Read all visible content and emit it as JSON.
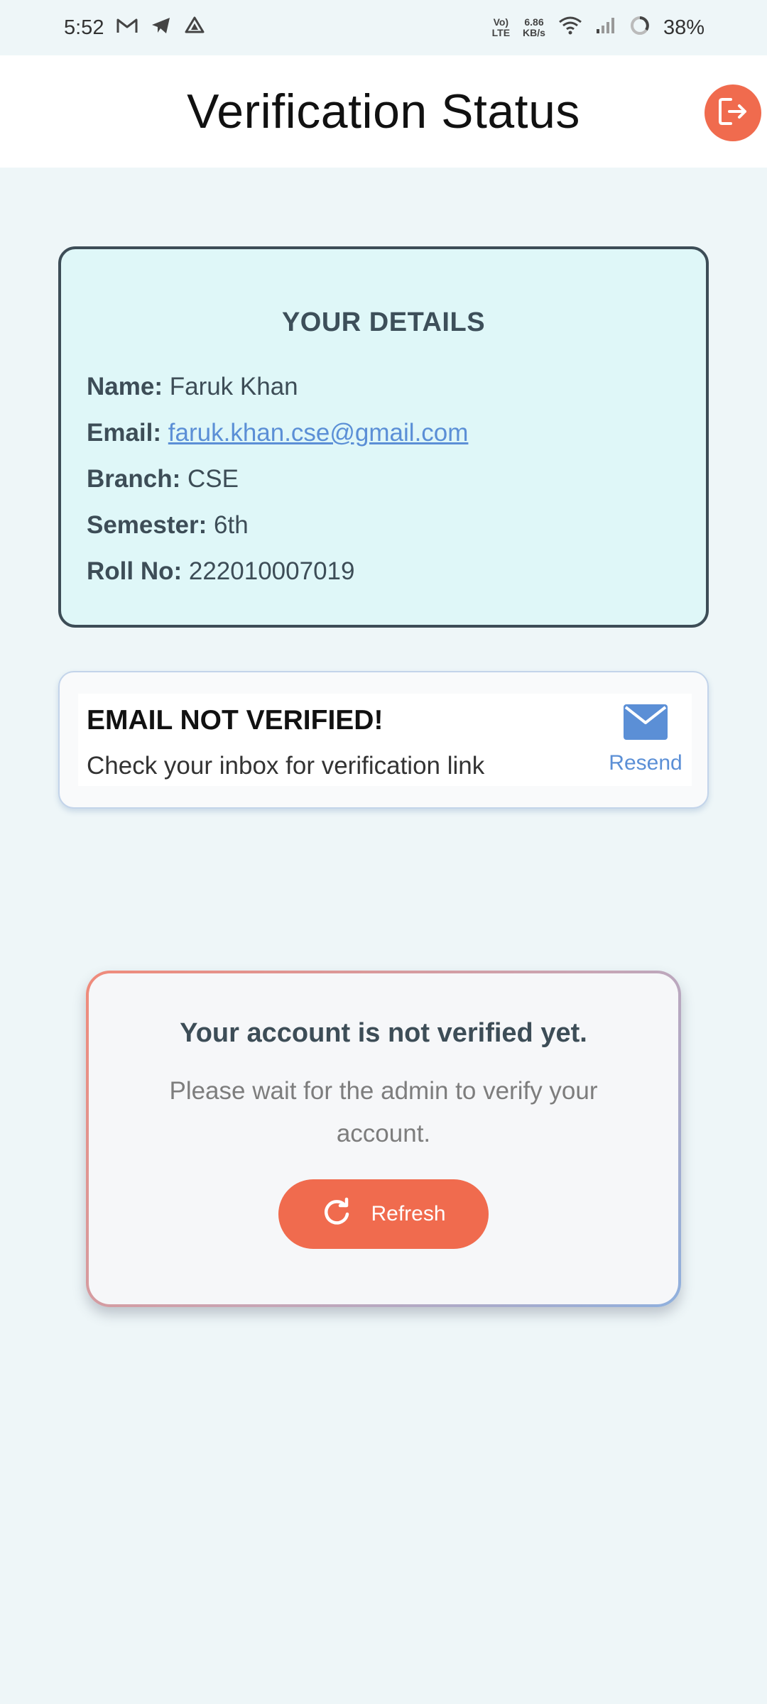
{
  "status_bar": {
    "time": "5:52",
    "net_top": "Vo)",
    "net_bottom": "LTE",
    "speed_value": "6.86",
    "speed_unit": "KB/s",
    "battery": "38%"
  },
  "app_bar": {
    "title": "Verification Status",
    "logout_icon": "logout-icon",
    "accent": "#f06b4e"
  },
  "details": {
    "title": "YOUR DETAILS",
    "rows": [
      {
        "label": "Name:",
        "value": "Faruk Khan"
      },
      {
        "label": "Email:",
        "value": "faruk.khan.cse@gmail.com"
      },
      {
        "label": "Branch:",
        "value": "CSE"
      },
      {
        "label": "Semester:",
        "value": "6th"
      },
      {
        "label": "Roll No:",
        "value": "222010007019"
      }
    ]
  },
  "email_notice": {
    "title": "EMAIL NOT VERIFIED!",
    "subtitle": "Check your inbox for verification link",
    "resend_label": "Resend",
    "icon": "mail-icon"
  },
  "account": {
    "title": "Your account is not verified yet.",
    "message": "Please wait for the admin to verify your account.",
    "refresh_label": "Refresh",
    "refresh_icon": "refresh-icon"
  },
  "colors": {
    "background": "#eef6f8",
    "card_border": "#3d4d57",
    "link": "#5b8fd6",
    "button": "#f06b4e"
  }
}
